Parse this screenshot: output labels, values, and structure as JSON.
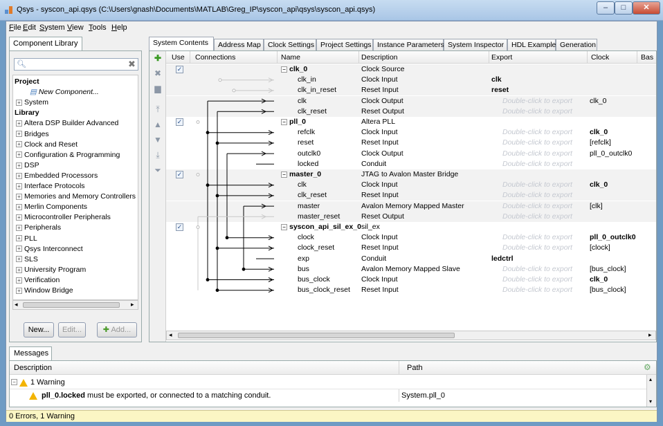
{
  "window": {
    "title": "Qsys - syscon_api.qsys (C:\\Users\\gnash\\Documents\\MATLAB\\Greg_IP\\syscon_api\\qsys\\syscon_api.qsys)",
    "min": "–",
    "max": "□",
    "close": "✕"
  },
  "menu": [
    "File",
    "Edit",
    "System",
    "View",
    "Tools",
    "Help"
  ],
  "library": {
    "tab": "Component Library",
    "search_icon": "search-icon",
    "tree": [
      {
        "label": "Project",
        "type": "header"
      },
      {
        "label": "New Component...",
        "type": "new"
      },
      {
        "label": "System",
        "type": "node"
      },
      {
        "label": "Library",
        "type": "header"
      },
      {
        "label": "Altera DSP Builder Advanced",
        "type": "node"
      },
      {
        "label": "Bridges",
        "type": "node"
      },
      {
        "label": "Clock and Reset",
        "type": "node"
      },
      {
        "label": "Configuration & Programming",
        "type": "node"
      },
      {
        "label": "DSP",
        "type": "node"
      },
      {
        "label": "Embedded Processors",
        "type": "node"
      },
      {
        "label": "Interface Protocols",
        "type": "node"
      },
      {
        "label": "Memories and Memory Controllers",
        "type": "node"
      },
      {
        "label": "Merlin Components",
        "type": "node"
      },
      {
        "label": "Microcontroller Peripherals",
        "type": "node"
      },
      {
        "label": "Peripherals",
        "type": "node"
      },
      {
        "label": "PLL",
        "type": "node"
      },
      {
        "label": "Qsys Interconnect",
        "type": "node"
      },
      {
        "label": "SLS",
        "type": "node"
      },
      {
        "label": "University Program",
        "type": "node"
      },
      {
        "label": "Verification",
        "type": "node"
      },
      {
        "label": "Window Bridge",
        "type": "node"
      }
    ],
    "buttons": {
      "new": "New...",
      "edit": "Edit...",
      "add": "Add..."
    }
  },
  "tabs": [
    "System Contents",
    "Address Map",
    "Clock Settings",
    "Project Settings",
    "Instance Parameters",
    "System Inspector",
    "HDL Example",
    "Generation"
  ],
  "grid": {
    "headers": {
      "use": "Use",
      "connections": "Connections",
      "name": "Name",
      "description": "Description",
      "export": "Export",
      "clock": "Clock",
      "base": "Bas"
    },
    "ghost_export": "Double-click to export",
    "rows": [
      {
        "name": "clk_0",
        "desc": "Clock Source",
        "export": "",
        "clock": "",
        "type": "comp",
        "use": true
      },
      {
        "name": "clk_in",
        "desc": "Clock Input",
        "export": "clk",
        "clock": "",
        "type": "port"
      },
      {
        "name": "clk_in_reset",
        "desc": "Reset Input",
        "export": "reset",
        "clock": "",
        "type": "port"
      },
      {
        "name": "clk",
        "desc": "Clock Output",
        "export": "",
        "clock": "clk_0",
        "type": "port",
        "ghost": true
      },
      {
        "name": "clk_reset",
        "desc": "Reset Output",
        "export": "",
        "clock": "",
        "type": "port",
        "ghost": true
      },
      {
        "name": "pll_0",
        "desc": "Altera PLL",
        "export": "",
        "clock": "",
        "type": "comp",
        "use": true
      },
      {
        "name": "refclk",
        "desc": "Clock Input",
        "export": "",
        "clock": "clk_0",
        "type": "port",
        "ghost": true,
        "clock_bold": true
      },
      {
        "name": "reset",
        "desc": "Reset Input",
        "export": "",
        "clock": "[refclk]",
        "type": "port",
        "ghost": true
      },
      {
        "name": "outclk0",
        "desc": "Clock Output",
        "export": "",
        "clock": "pll_0_outclk0",
        "type": "port",
        "ghost": true
      },
      {
        "name": "locked",
        "desc": "Conduit",
        "export": "",
        "clock": "",
        "type": "port",
        "ghost": true
      },
      {
        "name": "master_0",
        "desc": "JTAG to Avalon Master Bridge",
        "export": "",
        "clock": "",
        "type": "comp",
        "use": true
      },
      {
        "name": "clk",
        "desc": "Clock Input",
        "export": "",
        "clock": "clk_0",
        "type": "port",
        "ghost": true,
        "clock_bold": true
      },
      {
        "name": "clk_reset",
        "desc": "Reset Input",
        "export": "",
        "clock": "",
        "type": "port",
        "ghost": true
      },
      {
        "name": "master",
        "desc": "Avalon Memory Mapped Master",
        "export": "",
        "clock": "[clk]",
        "type": "port",
        "ghost": true
      },
      {
        "name": "master_reset",
        "desc": "Reset Output",
        "export": "",
        "clock": "",
        "type": "port",
        "ghost": true
      },
      {
        "name": "syscon_api_sil_ex_0",
        "desc": "sil_ex",
        "export": "",
        "clock": "",
        "type": "comp",
        "use": true
      },
      {
        "name": "clock",
        "desc": "Clock Input",
        "export": "",
        "clock": "pll_0_outclk0",
        "type": "port",
        "ghost": true,
        "clock_bold": true
      },
      {
        "name": "clock_reset",
        "desc": "Reset Input",
        "export": "",
        "clock": "[clock]",
        "type": "port",
        "ghost": true
      },
      {
        "name": "exp",
        "desc": "Conduit",
        "export": "ledctrl",
        "clock": "",
        "type": "port"
      },
      {
        "name": "bus",
        "desc": "Avalon Memory Mapped Slave",
        "export": "",
        "clock": "[bus_clock]",
        "type": "port",
        "ghost": true
      },
      {
        "name": "bus_clock",
        "desc": "Clock Input",
        "export": "",
        "clock": "clk_0",
        "type": "port",
        "ghost": true,
        "clock_bold": true
      },
      {
        "name": "bus_clock_reset",
        "desc": "Reset Input",
        "export": "",
        "clock": "[bus_clock]",
        "type": "port",
        "ghost": true
      }
    ]
  },
  "messages": {
    "tab": "Messages",
    "headers": {
      "description": "Description",
      "path": "Path"
    },
    "group": "1 Warning",
    "warning_bold": "pll_0.locked",
    "warning_text": " must be exported, or connected to a matching conduit.",
    "warning_path": "System.pll_0"
  },
  "status": "0 Errors, 1 Warning"
}
